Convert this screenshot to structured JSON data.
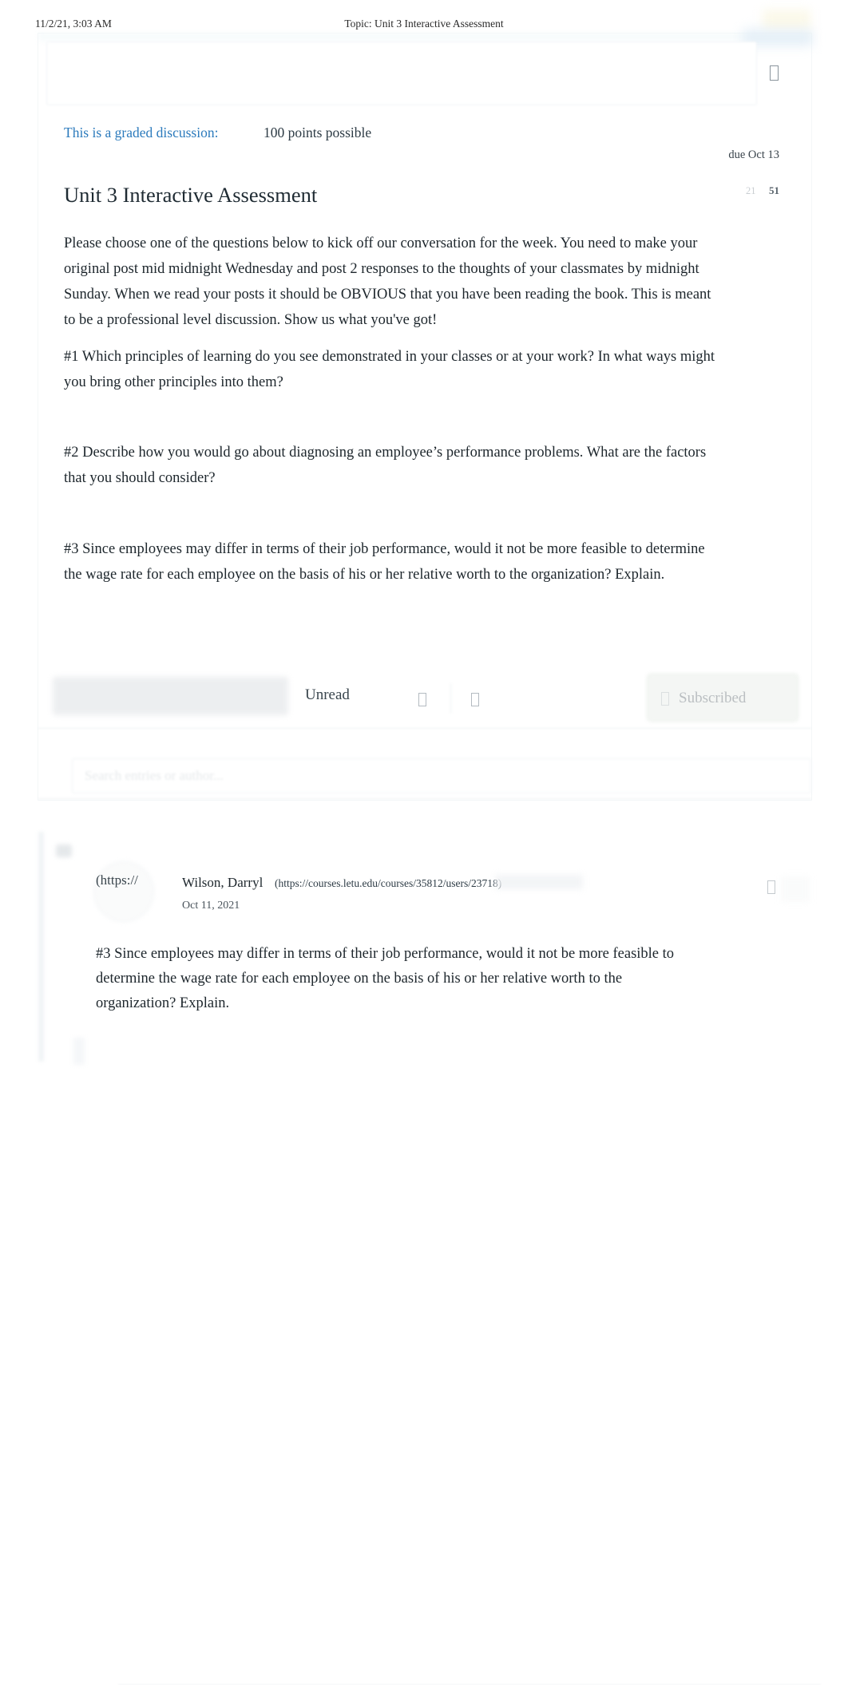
{
  "print_header": {
    "date": "11/2/21, 3:03 AM",
    "title": "Topic: Unit 3 Interactive Assessment"
  },
  "discussion": {
    "graded_label": "This is a graded discussion:",
    "points_possible": "100 points possible",
    "due": "due Oct 13",
    "title": "Unit 3 Interactive Assessment",
    "unread_count": "21",
    "total_count": "51",
    "paragraphs": [
      "Please choose one of the questions below to kick off our conversation for the week. You need to make your original post mid midnight Wednesday and post 2 responses to the thoughts of your classmates by midnight Sunday. When we read your posts it should be OBVIOUS that you have been reading the book. This is meant to be a professional level discussion. Show us what you've got!",
      "#1 Which principles of learning do you see demonstrated in your classes or at your work? In what ways might you bring other principles into them?",
      "#2 Describe how you would go about diagnosing an employee’s performance problems. What are the factors that you should consider?",
      "#3 Since employees may differ in terms of their job performance, would it not be more feasible to determine the wage rate for each employee on the basis of his or her relative worth to the organization? Explain."
    ]
  },
  "toolbar": {
    "reply_button_label": "",
    "unread_label": "Unread",
    "subscribed_label": "Subscribed",
    "icon_sort": "sort-icon",
    "icon_collapse": "collapse-icon",
    "icon_subscribe": "check-circle-icon",
    "icon_kebab": "kebab-menu-icon"
  },
  "search": {
    "placeholder": "Search entries or author..."
  },
  "reply": {
    "avatar_url_fragment": "(https://",
    "author": "Wilson, Darryl",
    "author_link": "(https://courses.letu.edu/courses/35812/users/23718)",
    "date": "Oct 11, 2021",
    "body": "#3 Since employees may differ in terms of their job performance, would it not be more feasible to determine the wage rate for each employee on the basis of his or her relative worth to the organization? Explain.",
    "icon_kebab": "kebab-menu-icon"
  },
  "colors": {
    "link_blue": "#2b7abc",
    "text": "#1d262c",
    "muted": "#8b9299"
  }
}
